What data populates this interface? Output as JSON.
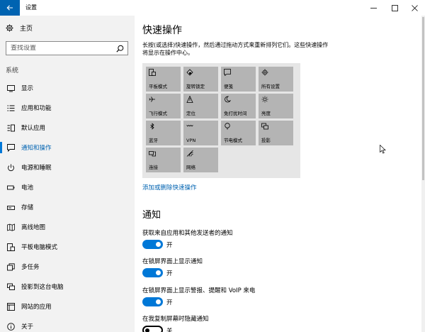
{
  "window": {
    "title": "设置",
    "back_icon": "arrow-left-icon",
    "minimize_glyph": "—",
    "maximize_glyph": "☐",
    "close_glyph": "✕"
  },
  "sidebar": {
    "home_label": "主页",
    "search_placeholder": "查找设置",
    "group_label": "系统",
    "items": [
      {
        "label": "显示",
        "icon": "display-icon"
      },
      {
        "label": "应用和功能",
        "icon": "apps-list-icon"
      },
      {
        "label": "默认应用",
        "icon": "default-apps-icon"
      },
      {
        "label": "通知和操作",
        "icon": "notification-icon",
        "active": true
      },
      {
        "label": "电源和睡眠",
        "icon": "power-icon"
      },
      {
        "label": "电池",
        "icon": "battery-icon"
      },
      {
        "label": "存储",
        "icon": "storage-icon"
      },
      {
        "label": "离线地图",
        "icon": "map-icon"
      },
      {
        "label": "平板电脑模式",
        "icon": "tablet-mode-icon"
      },
      {
        "label": "多任务",
        "icon": "multitasking-icon"
      },
      {
        "label": "投影到这台电脑",
        "icon": "project-icon"
      },
      {
        "label": "网站的应用",
        "icon": "web-apps-icon"
      },
      {
        "label": "关于",
        "icon": "info-icon"
      }
    ]
  },
  "main": {
    "quick_actions_title": "快速操作",
    "quick_actions_desc": "长按(或选择)快速操作，然后通过拖动方式来重新排列它们。这些快速操作将显示在操作中心。",
    "tiles": [
      {
        "label": "平板模式",
        "icon": "tablet-mode-icon"
      },
      {
        "label": "旋转锁定",
        "icon": "rotation-lock-icon"
      },
      {
        "label": "便笺",
        "icon": "note-icon"
      },
      {
        "label": "所有设置",
        "icon": "gear-icon"
      },
      {
        "label": "飞行模式",
        "icon": "airplane-icon"
      },
      {
        "label": "定位",
        "icon": "location-icon"
      },
      {
        "label": "免打扰时间",
        "icon": "moon-icon"
      },
      {
        "label": "亮度",
        "icon": "brightness-icon"
      },
      {
        "label": "蓝牙",
        "icon": "bluetooth-icon"
      },
      {
        "label": "VPN",
        "icon": "vpn-icon"
      },
      {
        "label": "节电模式",
        "icon": "battery-saver-icon"
      },
      {
        "label": "投影",
        "icon": "project-icon"
      },
      {
        "label": "连接",
        "icon": "connect-icon"
      },
      {
        "label": "网络",
        "icon": "network-icon"
      }
    ],
    "add_remove_link": "添加或删除快速操作",
    "notifications_title": "通知",
    "options": [
      {
        "label": "获取来自应用和其他发送者的通知",
        "state": "开",
        "on": true
      },
      {
        "label": "在锁屏界面上显示通知",
        "state": "开",
        "on": true
      },
      {
        "label": "在锁屏界面上显示警报、提醒和 VoIP 来电",
        "state": "开",
        "on": true
      },
      {
        "label": "在我复制屏幕时隐藏通知",
        "state": "关",
        "on": false
      }
    ]
  },
  "colors": {
    "accent": "#0078d7",
    "back_button": "#0063b1",
    "tile": "#b4b4b4",
    "tile_area": "#e6e6e6",
    "sidebar_bg": "#f2f2f2"
  }
}
